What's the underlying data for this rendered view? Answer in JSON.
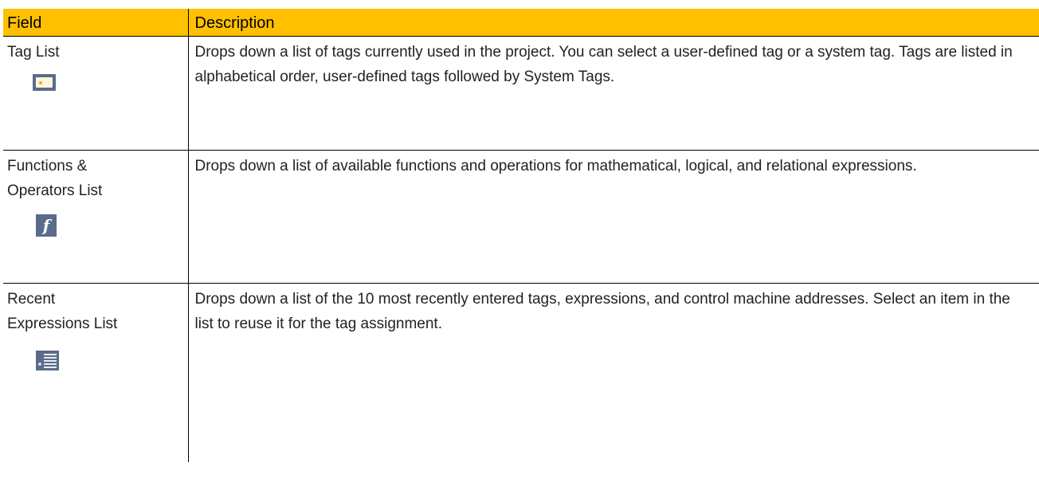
{
  "table": {
    "headers": {
      "field": "Field",
      "description": "Description"
    },
    "rows": [
      {
        "field": "Tag List",
        "icon": "tag-icon",
        "description": "Drops down a list of tags currently used in the project.  You can select a user-defined tag or a system tag.  Tags are listed in alphabetical order, user-defined tags followed by System Tags."
      },
      {
        "field_line1": "Functions &",
        "field_line2": "Operators List",
        "icon": "function-icon",
        "icon_glyph": "f",
        "description": "Drops down a list of available functions and operations for mathematical, logical, and relational expressions."
      },
      {
        "field_line1": "Recent",
        "field_line2": "Expressions List",
        "icon": "recent-list-icon",
        "description": "Drops down a list of the 10 most recently entered tags, expressions, and control machine addresses.  Select an item in the list to reuse it for the tag assignment."
      }
    ]
  },
  "colors": {
    "header_bg": "#ffc000",
    "icon_bg": "#5a6b8c"
  }
}
